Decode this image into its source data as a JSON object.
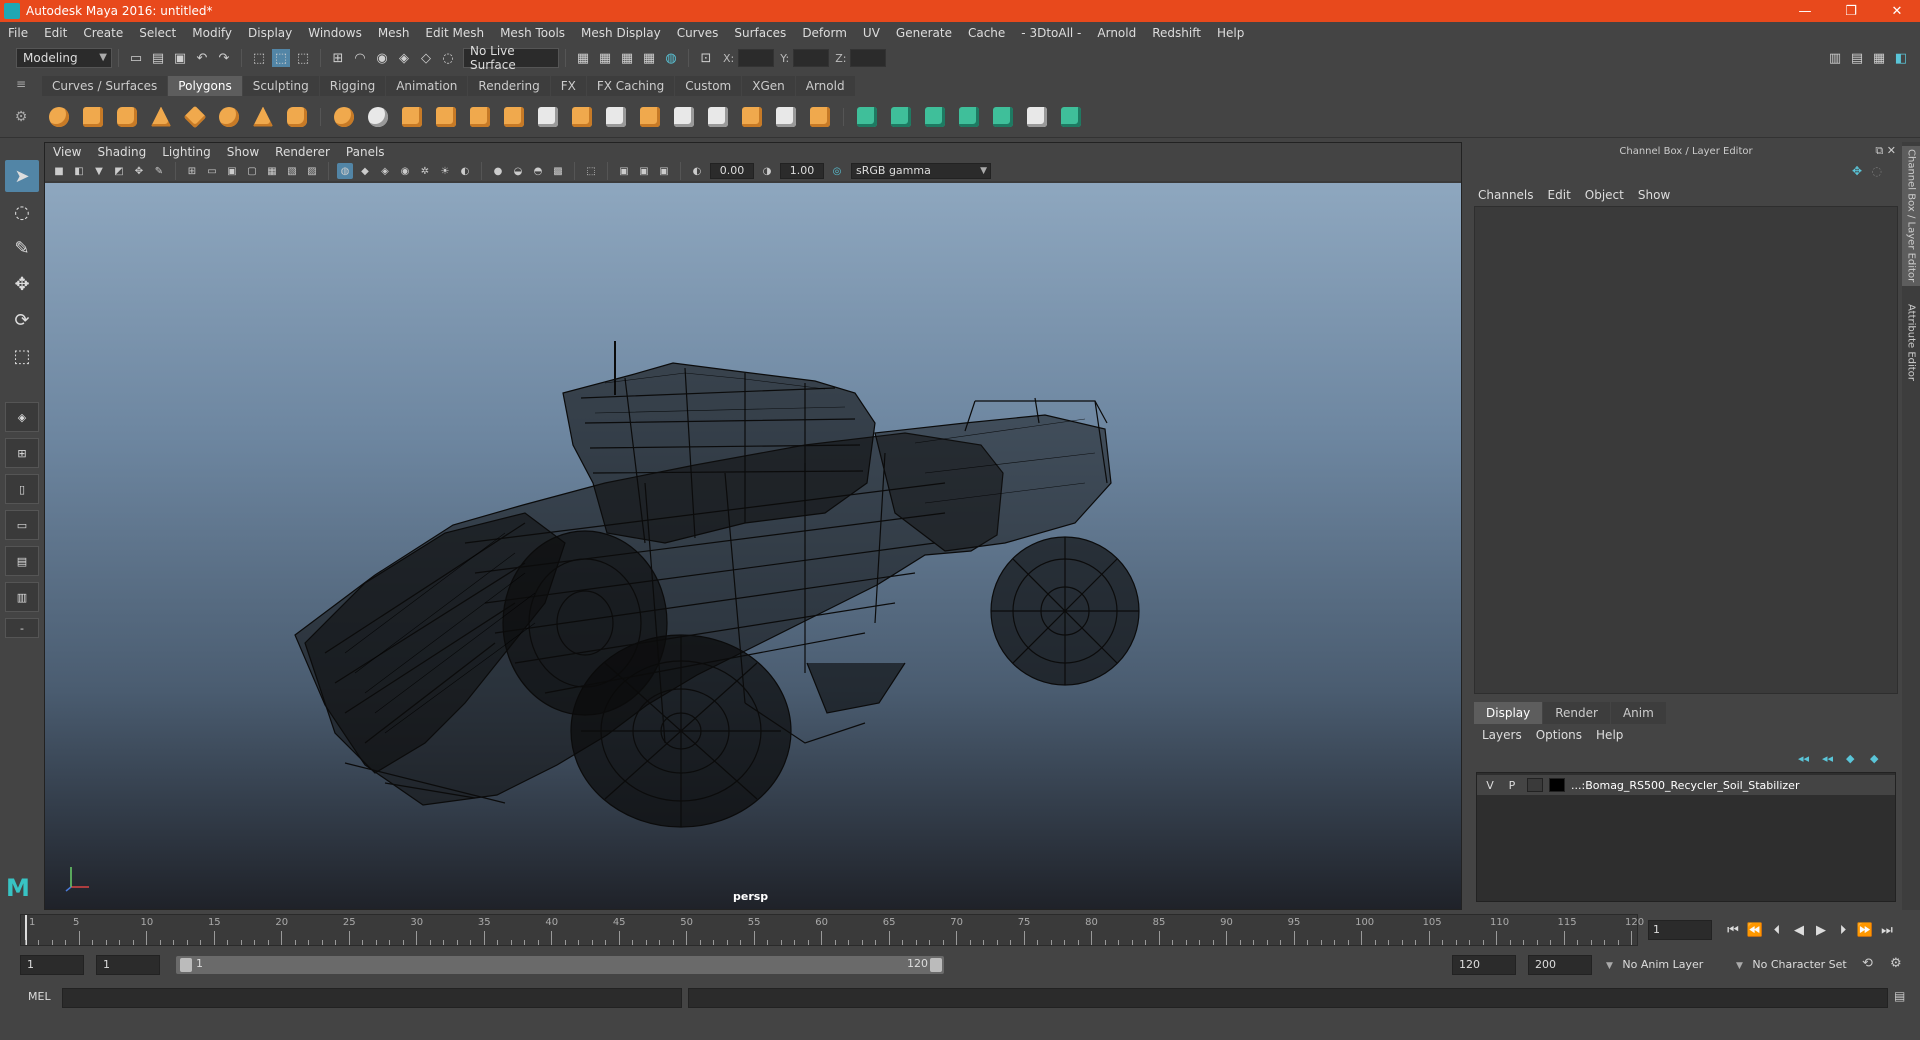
{
  "window": {
    "title": "Autodesk Maya 2016: untitled*",
    "minimize": "—",
    "restore": "❐",
    "close": "✕"
  },
  "menubar": [
    "File",
    "Edit",
    "Create",
    "Select",
    "Modify",
    "Display",
    "Windows",
    "Mesh",
    "Edit Mesh",
    "Mesh Tools",
    "Mesh Display",
    "Curves",
    "Surfaces",
    "Deform",
    "UV",
    "Generate",
    "Cache",
    "- 3DtoAll -",
    "Arnold",
    "Redshift",
    "Help"
  ],
  "statusline": {
    "mode": "Modeling",
    "live_surface": "No Live Surface",
    "x_label": "X:",
    "y_label": "Y:",
    "z_label": "Z:"
  },
  "shelf": {
    "tabs": [
      "Curves / Surfaces",
      "Polygons",
      "Sculpting",
      "Rigging",
      "Animation",
      "Rendering",
      "FX",
      "FX Caching",
      "Custom",
      "XGen",
      "Arnold"
    ],
    "active_tab": "Polygons"
  },
  "viewport": {
    "menus": [
      "View",
      "Shading",
      "Lighting",
      "Show",
      "Renderer",
      "Panels"
    ],
    "exposure": "0.00",
    "gamma": "1.00",
    "color_space": "sRGB gamma",
    "camera": "persp"
  },
  "channelbox": {
    "header": "Channel Box / Layer Editor",
    "menus": [
      "Channels",
      "Edit",
      "Object",
      "Show"
    ]
  },
  "layer_editor": {
    "tabs": [
      "Display",
      "Render",
      "Anim"
    ],
    "active_tab": "Display",
    "menus": [
      "Layers",
      "Options",
      "Help"
    ],
    "layers": [
      {
        "visible": "V",
        "playback": "P",
        "name": "...:Bomag_RS500_Recycler_Soil_Stabilizer"
      }
    ]
  },
  "side_tabs": {
    "channel_box": "Channel Box / Layer Editor",
    "attribute_editor": "Attribute Editor"
  },
  "timeline": {
    "ticks": [
      "5",
      "10",
      "15",
      "20",
      "25",
      "30",
      "35",
      "40",
      "45",
      "50",
      "55",
      "60",
      "65",
      "70",
      "75",
      "80",
      "85",
      "90",
      "95",
      "100",
      "105",
      "110",
      "115",
      "120"
    ],
    "first_label": "1",
    "current_frame": "1",
    "range_total": 120
  },
  "range": {
    "start": "1",
    "playback_start": "1",
    "slider_start": "1",
    "slider_end": "120",
    "playback_end": "120",
    "end": "200",
    "anim_layer": "No Anim Layer",
    "character_set": "No Character Set"
  },
  "cmdline": {
    "label": "MEL"
  }
}
